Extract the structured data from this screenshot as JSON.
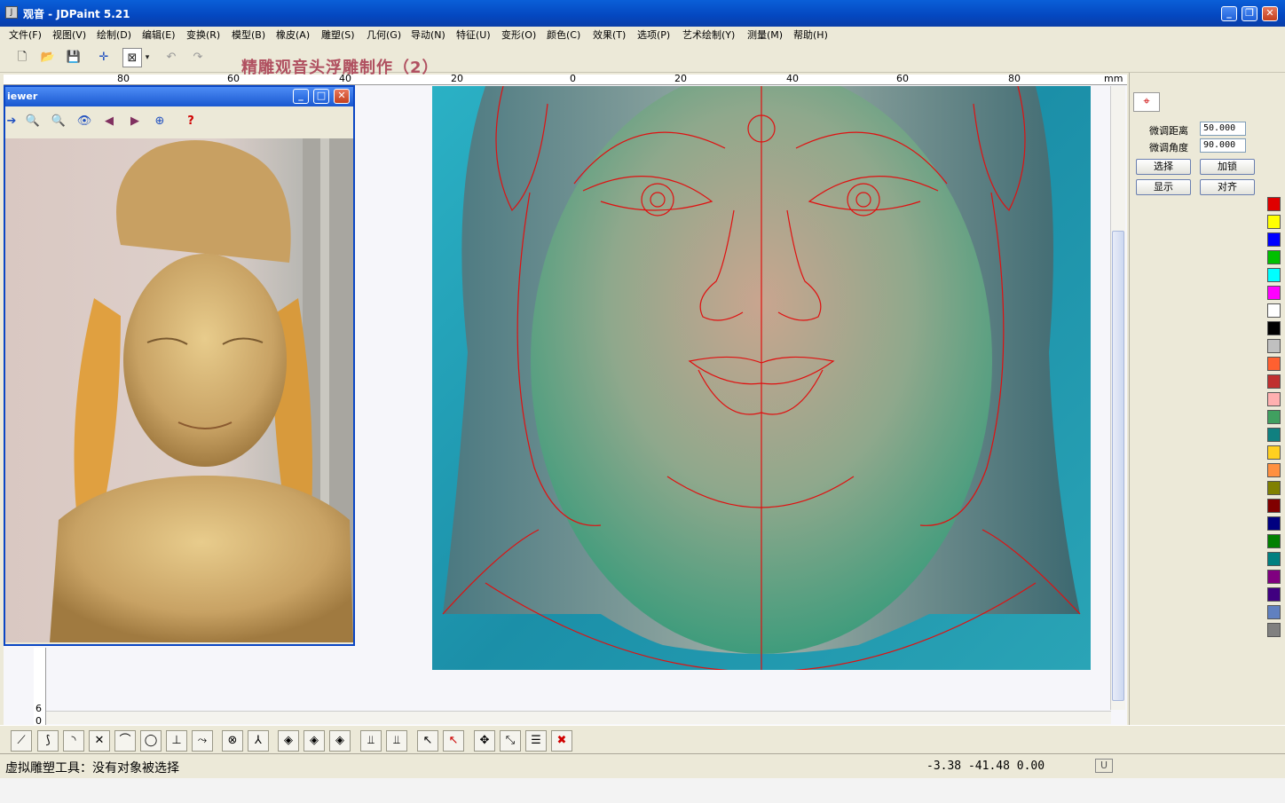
{
  "window": {
    "title": "观音 - JDPaint 5.21"
  },
  "menu": [
    "文件(F)",
    "视图(V)",
    "绘制(D)",
    "编辑(E)",
    "变换(R)",
    "模型(B)",
    "橡皮(A)",
    "雕塑(S)",
    "几何(G)",
    "导动(N)",
    "特征(U)",
    "变形(O)",
    "颜色(C)",
    "效果(T)",
    "选项(P)",
    "艺术绘制(Y)",
    "测量(M)",
    "帮助(H)"
  ],
  "overlay_title": "精雕观音头浮雕制作（2）",
  "ruler": {
    "unit": "mm",
    "ticks": [
      "80",
      "60",
      "40",
      "20",
      "0",
      "20",
      "40",
      "60",
      "80"
    ],
    "vticks": [
      "6",
      "0"
    ]
  },
  "viewer": {
    "title": "iewer",
    "help_glyph": "?"
  },
  "panel": {
    "distance_label": "微调距离",
    "distance_value": "50.000",
    "angle_label": "微调角度",
    "angle_value": "90.000",
    "btn_select": "选择",
    "btn_lock": "加锁",
    "btn_show": "显示",
    "btn_align": "对齐"
  },
  "palette": [
    "#e00000",
    "#ffff00",
    "#0000ff",
    "#00c000",
    "#00ffff",
    "#ff00ff",
    "#ffffff",
    "#000000",
    "#c0c0c0",
    "#ff6030",
    "#c03030",
    "#ffb0b0",
    "#40a060",
    "#108080",
    "#ffd020",
    "#ff9040",
    "#808000",
    "#800000",
    "#000080",
    "#008000",
    "#008080",
    "#800080",
    "#400080",
    "#6080c0",
    "#808080"
  ],
  "status": {
    "text": "虚拟雕塑工具：没有对象被选择",
    "coords": "-3.38  -41.48  0.00",
    "badge": "U"
  }
}
